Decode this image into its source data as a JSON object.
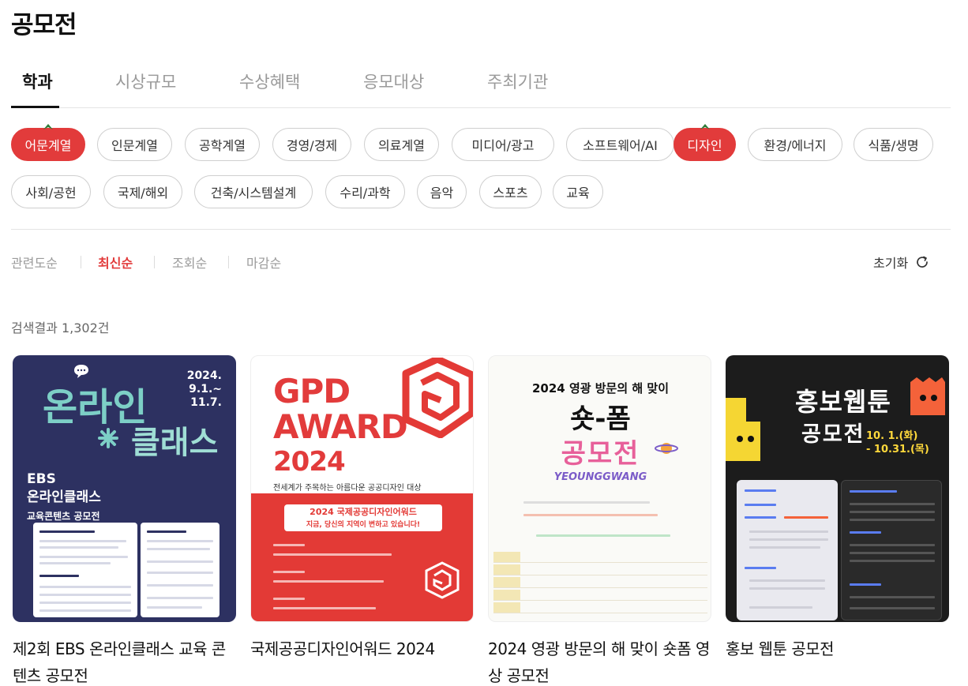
{
  "page": {
    "title": "공모전"
  },
  "tabs": [
    {
      "label": "학과",
      "active": true
    },
    {
      "label": "시상규모",
      "active": false
    },
    {
      "label": "수상혜택",
      "active": false
    },
    {
      "label": "응모대상",
      "active": false
    },
    {
      "label": "주최기관",
      "active": false
    }
  ],
  "chips": [
    {
      "label": "어문계열",
      "active": true
    },
    {
      "label": "인문계열",
      "active": false
    },
    {
      "label": "공학계열",
      "active": false
    },
    {
      "label": "경영/경제",
      "active": false
    },
    {
      "label": "의료계열",
      "active": false
    },
    {
      "label": "미디어/광고",
      "active": false
    },
    {
      "label": "소프트웨어/AI",
      "active": false
    },
    {
      "label": "디자인",
      "active": true
    },
    {
      "label": "환경/에너지",
      "active": false
    },
    {
      "label": "식품/생명",
      "active": false
    },
    {
      "label": "사회/공헌",
      "active": false
    },
    {
      "label": "국제/해외",
      "active": false
    },
    {
      "label": "건축/시스템설계",
      "active": false
    },
    {
      "label": "수리/과학",
      "active": false
    },
    {
      "label": "음악",
      "active": false
    },
    {
      "label": "스포츠",
      "active": false
    },
    {
      "label": "교육",
      "active": false
    }
  ],
  "sorts": [
    {
      "label": "관련도순",
      "active": false
    },
    {
      "label": "최신순",
      "active": true
    },
    {
      "label": "조회순",
      "active": false
    },
    {
      "label": "마감순",
      "active": false
    }
  ],
  "reset": {
    "label": "초기화",
    "icon": "refresh-icon"
  },
  "results": {
    "text": "검색결과 1,302건"
  },
  "colors": {
    "accent": "#e23b3b",
    "leaf": "#2e7d3a"
  },
  "cards": [
    {
      "title": "제2회 EBS 온라인클래스 교육 콘텐츠 공모전",
      "poster": {
        "date": "2024.\n9.1.~\n11.7.",
        "headline_a": "온라인",
        "headline_b": "클래스",
        "brand": "EBS",
        "brand_line": "온라인클래스",
        "brand_sub": "교육콘텐츠 공모전"
      }
    },
    {
      "title": "국제공공디자인어워드 2024",
      "poster": {
        "brand": "GPD",
        "brand_line": "AWARD",
        "year": "2024",
        "sub": "전세계가 주목하는 아름다운 공공디자인 대상",
        "banner_1": "2024 국제공공디자인어워드",
        "banner_2": "지금, 당신의 지역이 변하고 있습니다!"
      }
    },
    {
      "title": "2024 영광 방문의 해 맞이 숏폼 영상 공모전",
      "poster": {
        "head": "2024 영광 방문의 해 맞이",
        "shorts": "숏-폼",
        "contest": "공모전",
        "yg": "YEOUNGGWANG"
      }
    },
    {
      "title": "홍보 웹툰 공모전",
      "poster": {
        "line_1": "홍보웹툰",
        "line_2": "공모전",
        "date": "10. 1.(화)\n- 10.31.(목)"
      }
    }
  ]
}
